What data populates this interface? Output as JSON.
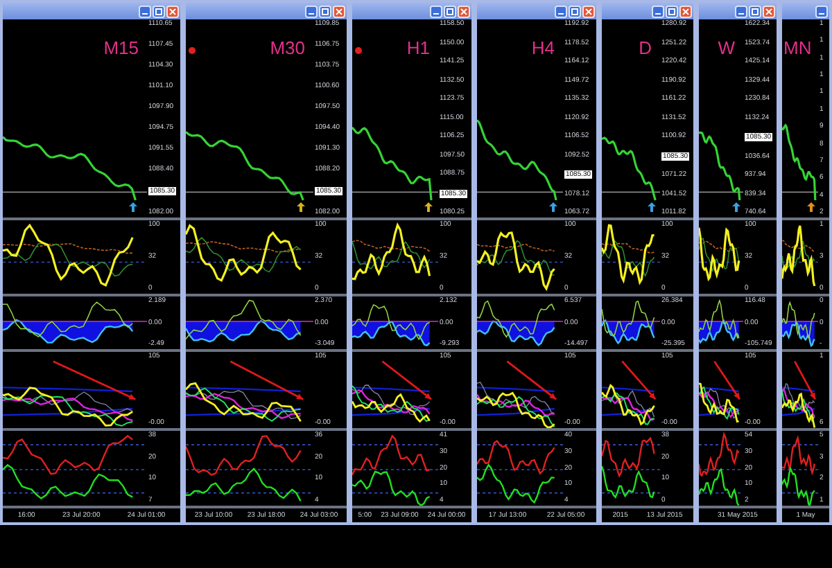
{
  "windows": [
    {
      "timeframe": "M15",
      "buttons": [
        {
          "kind": "minimize"
        },
        {
          "kind": "maximize"
        },
        {
          "kind": "close"
        }
      ],
      "price_ticks_upper": [
        "1110.65",
        "1107.45",
        "1104.30",
        "1101.10",
        "1097.90",
        "1094.75",
        "1091.55",
        "1088.40"
      ],
      "price_tag": "1085.30",
      "price_ticks_lower": [
        "1082.00"
      ],
      "top_marker": false,
      "signal_arrow": {
        "color": "#3aa0e0"
      },
      "osc_ticks": [
        "100",
        "32",
        "0"
      ],
      "macd_ticks": [
        "2.189",
        "0.00",
        "-2.49"
      ],
      "stoch_ticks": [
        "105",
        "-0.00"
      ],
      "adx_ticks": [
        "38",
        "20",
        "10",
        "7"
      ],
      "dates": [
        "16:00",
        "23 Jul 20:00",
        "24 Jul 01:00"
      ]
    },
    {
      "timeframe": "M30",
      "buttons": [
        {
          "kind": "minimize"
        },
        {
          "kind": "maximize"
        },
        {
          "kind": "close"
        }
      ],
      "price_ticks_upper": [
        "1109.85",
        "1106.75",
        "1103.75",
        "1100.60",
        "1097.50",
        "1094.40",
        "1091.30",
        "1088.20"
      ],
      "price_tag": "1085.30",
      "price_ticks_lower": [
        "1082.00"
      ],
      "top_marker": true,
      "signal_arrow": {
        "color": "#d8b020"
      },
      "osc_ticks": [
        "100",
        "32",
        "0"
      ],
      "macd_ticks": [
        "2.370",
        "0.00",
        "-3.049"
      ],
      "stoch_ticks": [
        "105",
        "-0.00"
      ],
      "adx_ticks": [
        "36",
        "20",
        "10",
        "4"
      ],
      "dates": [
        "23 Jul 10:00",
        "23 Jul 18:00",
        "24 Jul 03:00"
      ]
    },
    {
      "timeframe": "H1",
      "buttons": [
        {
          "kind": "minimize"
        },
        {
          "kind": "maximize"
        },
        {
          "kind": "close"
        }
      ],
      "price_ticks_upper": [
        "1158.50",
        "1150.00",
        "1141.25",
        "1132.50",
        "1123.75",
        "1115.00",
        "1106.25",
        "1097.50",
        "1088.75"
      ],
      "price_tag": "1085.30",
      "price_ticks_lower": [
        "1080.25"
      ],
      "top_marker": true,
      "signal_arrow": {
        "color": "#d8b020"
      },
      "osc_ticks": [
        "100",
        "32",
        "0"
      ],
      "macd_ticks": [
        "2.132",
        "0.00",
        "-9.293"
      ],
      "stoch_ticks": [
        "105",
        "-0.00"
      ],
      "adx_ticks": [
        "41",
        "30",
        "20",
        "10",
        "4"
      ],
      "dates": [
        "5:00",
        "23 Jul 09:00",
        "24 Jul 00:00"
      ]
    },
    {
      "timeframe": "H4",
      "buttons": [
        {
          "kind": "minimize"
        },
        {
          "kind": "maximize"
        },
        {
          "kind": "close"
        }
      ],
      "price_ticks_upper": [
        "1192.92",
        "1178.52",
        "1164.12",
        "1149.72",
        "1135.32",
        "1120.92",
        "1106.52",
        "1092.52"
      ],
      "price_tag": "1085.30",
      "price_ticks_lower": [
        "1078.12",
        "1063.72"
      ],
      "top_marker": false,
      "signal_arrow": {
        "color": "#3aa0e0"
      },
      "osc_ticks": [
        "100",
        "32",
        "0"
      ],
      "macd_ticks": [
        "6.537",
        "0.00",
        "-14.497"
      ],
      "stoch_ticks": [
        "105",
        "-0.00"
      ],
      "adx_ticks": [
        "40",
        "30",
        "20",
        "10",
        "4"
      ],
      "dates": [
        "17 Jul 13:00",
        "22 Jul 05:00"
      ]
    },
    {
      "timeframe": "D",
      "buttons": [
        {
          "kind": "minimize"
        },
        {
          "kind": "maximize"
        },
        {
          "kind": "close"
        }
      ],
      "price_ticks_upper": [
        "1280.92",
        "1251.22",
        "1220.42",
        "1190.92",
        "1161.22",
        "1131.52",
        "1100.92"
      ],
      "price_tag": "1085.30",
      "price_ticks_lower": [
        "1071.22",
        "1041.52",
        "1011.82"
      ],
      "top_marker": false,
      "signal_arrow": {
        "color": "#3aa0e0"
      },
      "osc_ticks": [
        "100",
        "32",
        "0"
      ],
      "macd_ticks": [
        "26.384",
        "0.00",
        "-25.395"
      ],
      "stoch_ticks": [
        "105",
        "-0.00"
      ],
      "adx_ticks": [
        "38",
        "20",
        "10",
        "0"
      ],
      "dates": [
        "2015",
        "13 Jul 2015"
      ]
    },
    {
      "timeframe": "W",
      "buttons": [
        {
          "kind": "minimize"
        },
        {
          "kind": "maximize"
        },
        {
          "kind": "close"
        }
      ],
      "price_ticks_upper": [
        "1622.34",
        "1523.74",
        "1425.14",
        "1329.44",
        "1230.84",
        "1132.24"
      ],
      "price_tag": "1085.30",
      "price_ticks_lower": [
        "1036.64",
        "937.94",
        "839.34",
        "740.64"
      ],
      "top_marker": false,
      "signal_arrow": {
        "color": "#3aa0e0"
      },
      "osc_ticks": [
        "100",
        "32",
        "0"
      ],
      "macd_ticks": [
        "116.48",
        "0.00",
        "-105.749"
      ],
      "stoch_ticks": [
        "105",
        "-0.00"
      ],
      "adx_ticks": [
        "54",
        "30",
        "20",
        "10",
        "2"
      ],
      "dates": [
        "31 May 2015"
      ]
    },
    {
      "timeframe": "MN",
      "buttons": [
        {
          "kind": "minimize"
        }
      ],
      "price_ticks_upper": [
        "1",
        "1",
        "1",
        "1",
        "1",
        "1",
        "9",
        "8",
        "7",
        "6",
        "4",
        "2"
      ],
      "top_marker": false,
      "signal_arrow": {
        "color": "#e09020"
      },
      "osc_ticks": [
        "1",
        "3",
        "0"
      ],
      "macd_ticks": [
        "0",
        "0",
        "-"
      ],
      "stoch_ticks": [
        "1",
        "6"
      ],
      "adx_ticks": [
        "5",
        "3",
        "2",
        "1"
      ],
      "dates": [
        "1 May"
      ]
    }
  ]
}
